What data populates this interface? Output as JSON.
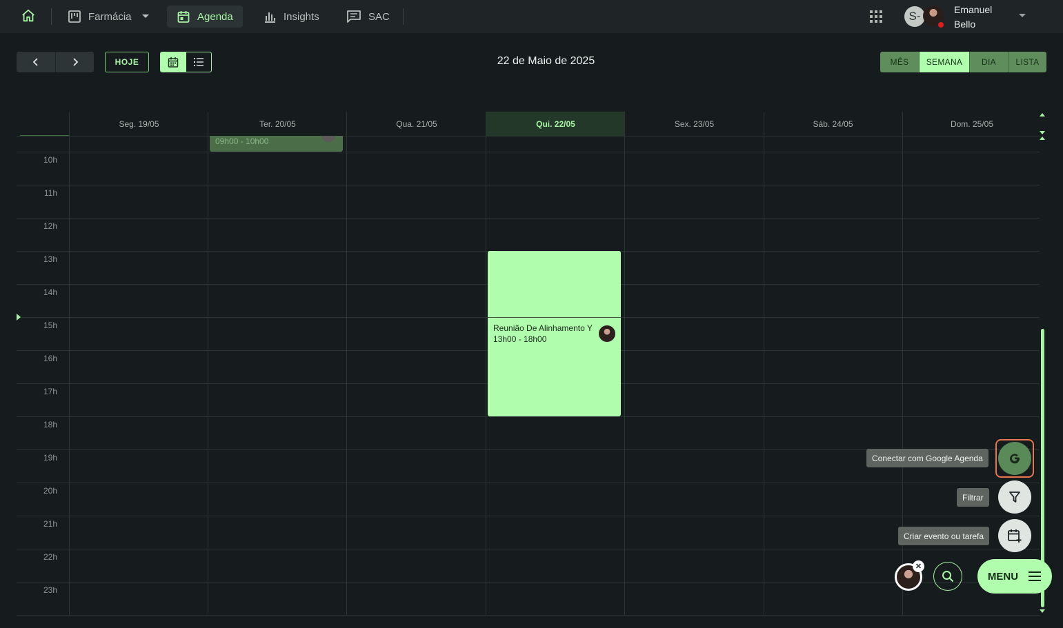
{
  "nav": {
    "items": [
      {
        "label": "Farmácia",
        "icon": "kanban-icon"
      },
      {
        "label": "Agenda",
        "icon": "calendar-icon",
        "active": true
      },
      {
        "label": "Insights",
        "icon": "bar-chart-icon"
      },
      {
        "label": "SAC",
        "icon": "chat-icon"
      }
    ],
    "avatar_initial": "S-",
    "user_name": "Emanuel Bello"
  },
  "toolbar": {
    "today_label": "HOJE",
    "date_title": "22 de Maio de 2025",
    "views": [
      "MÊS",
      "SEMANA",
      "DIA",
      "LISTA"
    ],
    "selected_view": "SEMANA"
  },
  "calendar": {
    "days": [
      "Seg. 19/05",
      "Ter. 20/05",
      "Qua. 21/05",
      "Qui. 22/05",
      "Sex. 23/05",
      "Sáb. 24/05",
      "Dom. 25/05"
    ],
    "today_index": 3,
    "hours": [
      "10h",
      "11h",
      "12h",
      "13h",
      "14h",
      "15h",
      "16h",
      "17h",
      "18h",
      "19h",
      "20h",
      "21h",
      "22h",
      "23h"
    ],
    "partial_event_time": "09h00 - 10h00",
    "event": {
      "title": "Reunião De Alinhamento Y",
      "time": "13h00 - 18h00"
    }
  },
  "fab": {
    "google_tip": "Conectar com Google Agenda",
    "filter_tip": "Filtrar",
    "create_tip": "Criar evento ou tarefa",
    "menu_label": "MENU"
  },
  "colors": {
    "accent": "#b1fdae",
    "background": "#161c1e",
    "topbar": "#1f2527"
  }
}
